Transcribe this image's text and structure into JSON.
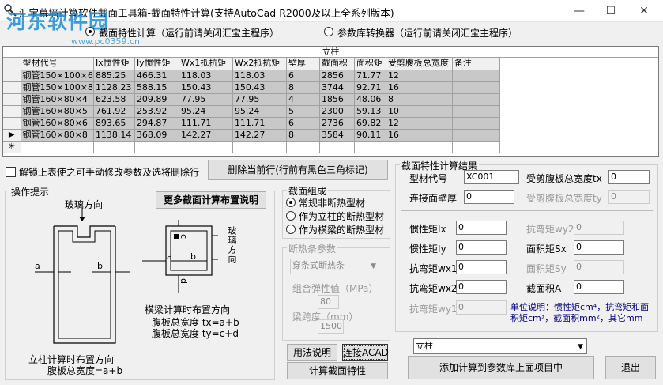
{
  "window": {
    "title": "汇宝幕墙计算软件截面工具箱-截面特性计算(支持AutoCad R2000及以上全系列版本)",
    "minimize": "—",
    "maximize": "☐",
    "close": "✕"
  },
  "watermark": {
    "name": "河东软件园",
    "url": "www.pc0359.cn"
  },
  "modes": {
    "section_calc": "截面特性计算（运行前请关闭汇宝主程序）",
    "converter": "参数库转换器（运行前请关闭汇宝主程序）"
  },
  "table": {
    "caption": "立柱",
    "columns": [
      "型材代号",
      "Ix惯性矩",
      "Iy惯性矩",
      "Wx1抵抗矩",
      "Wx2抵抗矩",
      "壁厚",
      "截面积",
      "面积矩",
      "受剪腹板总宽度",
      "备注"
    ],
    "rows": [
      [
        "钢管150×100×6",
        "885.25",
        "466.31",
        "118.03",
        "118.03",
        "6",
        "2856",
        "71.77",
        "12",
        ""
      ],
      [
        "钢管150×100×8",
        "1128.23",
        "588.15",
        "150.43",
        "150.43",
        "8",
        "3744",
        "92.71",
        "16",
        ""
      ],
      [
        "钢管160×80×4",
        "623.58",
        "209.89",
        "77.95",
        "77.95",
        "4",
        "1856",
        "48.06",
        "8",
        ""
      ],
      [
        "钢管160×80×5",
        "761.92",
        "253.92",
        "95.24",
        "95.24",
        "5",
        "2300",
        "59.13",
        "10",
        ""
      ],
      [
        "钢管160×80×6",
        "893.65",
        "294.87",
        "111.71",
        "111.71",
        "6",
        "2736",
        "69.82",
        "12",
        ""
      ],
      [
        "钢管160×80×8",
        "1138.14",
        "368.09",
        "142.27",
        "142.27",
        "8",
        "3584",
        "90.11",
        "16",
        ""
      ]
    ],
    "current_marker": "▶",
    "new_marker": "✳"
  },
  "unlock_label": "解锁上表使之可手动修改参数及选将删除行",
  "delete_button": "删除当前行(行前有黑色三角标记)",
  "hints": {
    "legend": "操作提示",
    "more_button": "更多截面计算布置说明",
    "glass_dir": "玻璃方向",
    "glass_dir_vertical": "玻璃方向",
    "label_a": "a",
    "label_b": "b",
    "label_c": "c",
    "label_d": "d",
    "beam_title": "横梁计算时布置方向",
    "beam_tx": "腹板总宽度 tx=a+b",
    "beam_ty": "腹板总宽度 ty=c+d",
    "column_title": "立柱计算时布置方向",
    "column_width": "腹板总宽度=a+b"
  },
  "composition": {
    "legend": "截面组成",
    "options": [
      "常规非断热型材",
      "作为立柱的断热型材",
      "作为横梁的断热型材"
    ]
  },
  "thermal": {
    "legend": "断热条参数",
    "type_value": "穿条式断热条",
    "elastic_label": "组合弹性值（MPa）",
    "elastic_value": "80",
    "span_label": "梁跨度（mm）",
    "span_value": "1500"
  },
  "usage_button": "用法说明",
  "connect_button": "连接ACAD",
  "calc_button": "计算截面特性",
  "results": {
    "legend": "截面特性计算结果",
    "code_label": "型材代号",
    "code_value": "XC001",
    "shear_tx_label": "受剪腹板总宽度tx",
    "shear_tx_value": "0",
    "wall_label": "连接面壁厚",
    "wall_value": "0",
    "shear_ty_label": "受剪腹板总宽度ty",
    "shear_ty_value": "0",
    "ix_label": "惯性矩Ix",
    "ix_value": "0",
    "wy2_label": "抗弯矩wy2",
    "wy2_value": "0",
    "iy_label": "惯性矩Iy",
    "iy_value": "0",
    "sx_label": "面积矩Sx",
    "sx_value": "0",
    "wx1_label": "抗弯矩wx1",
    "wx1_value": "0",
    "sy_label": "面积矩Sy",
    "sy_value": "0",
    "wx2_label": "抗弯矩wx2",
    "wx2_value": "0",
    "area_label": "截面积A",
    "area_value": "0",
    "wy1_label": "抗弯矩wy1",
    "wy1_value": "0",
    "unit_line1": "单位说明：惯性矩cm⁴，抗弯矩和面",
    "unit_line2": "积矩cm³，截面积mm²，其它mm"
  },
  "target_select": "立柱",
  "add_button": "添加计算到参数库上面项目中",
  "exit_button": "退出",
  "colors": {
    "watermark": "#1b8ed6",
    "unit_text": "#000080"
  }
}
